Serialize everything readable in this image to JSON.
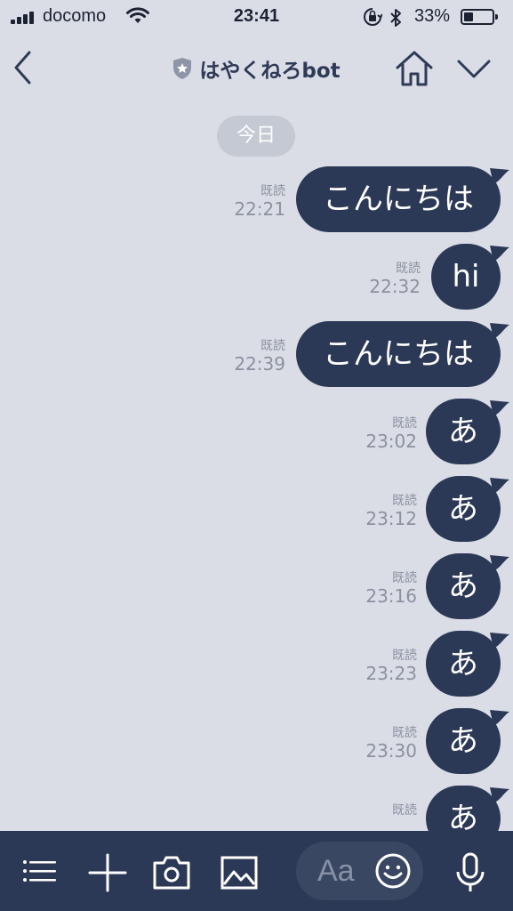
{
  "status_bar": {
    "carrier": "docomo",
    "time": "23:41",
    "battery_percent": "33%",
    "battery_level": 0.33
  },
  "header": {
    "title": "はやくねろbot"
  },
  "date_chip": "今日",
  "messages": [
    {
      "text": "こんにちは",
      "read": "既読",
      "time": "22:21"
    },
    {
      "text": "hi",
      "read": "既読",
      "time": "22:32"
    },
    {
      "text": "こんにちは",
      "read": "既読",
      "time": "22:39"
    },
    {
      "text": "あ",
      "read": "既読",
      "time": "23:02"
    },
    {
      "text": "あ",
      "read": "既読",
      "time": "23:12"
    },
    {
      "text": "あ",
      "read": "既読",
      "time": "23:16"
    },
    {
      "text": "あ",
      "read": "既読",
      "time": "23:23"
    },
    {
      "text": "あ",
      "read": "既読",
      "time": "23:30"
    },
    {
      "text": "あ",
      "read": "既読",
      "time": ""
    }
  ],
  "input": {
    "placeholder": "Aa"
  },
  "icons": {
    "back": "chevron-left-icon",
    "verified": "shield-star-icon",
    "home": "home-icon",
    "menu": "chevron-down-icon",
    "list": "list-menu-icon",
    "add": "plus-icon",
    "camera": "camera-icon",
    "image": "image-icon",
    "emoji": "smiley-icon",
    "mic": "microphone-icon"
  },
  "colors": {
    "background": "#dadde6",
    "bubble": "#2c3956",
    "toolbar": "#2c3956"
  }
}
